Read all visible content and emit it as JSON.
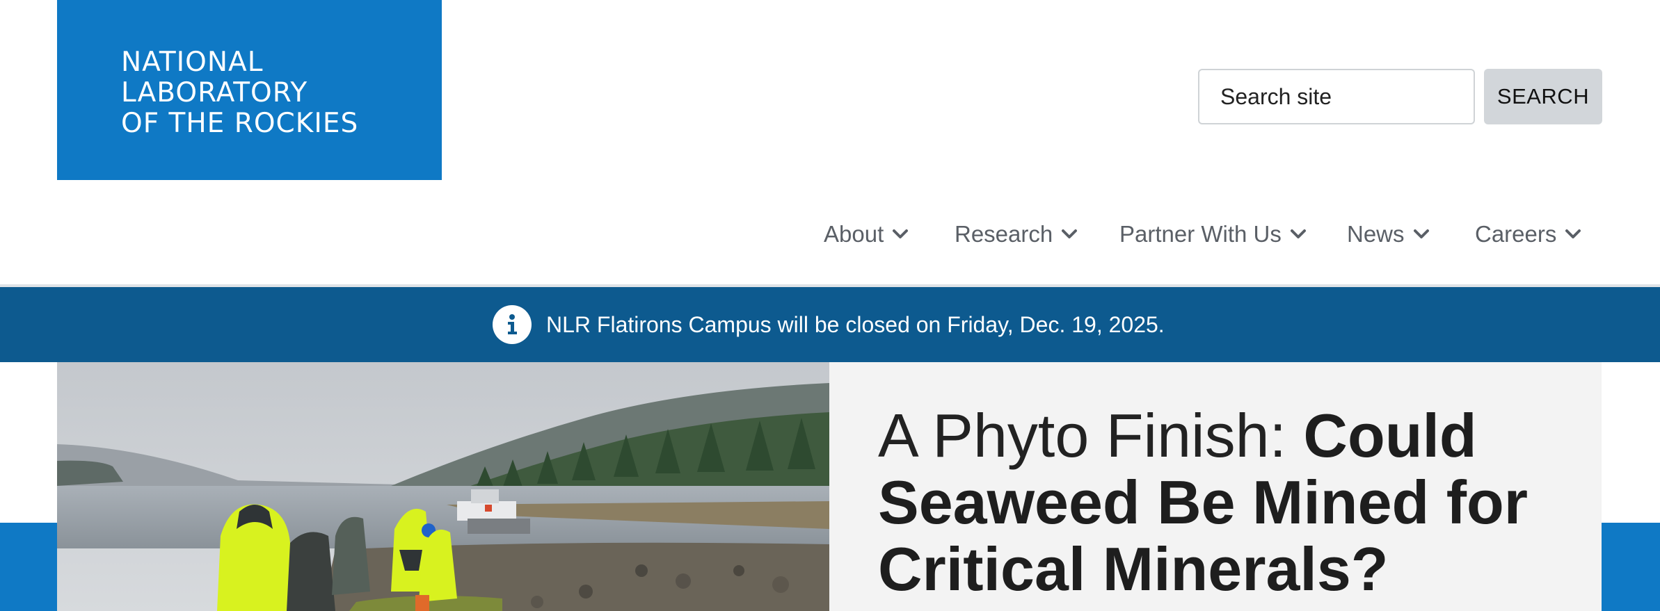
{
  "header": {
    "logo_lines": [
      "NATIONAL",
      "LABORATORY",
      "OF THE ROCKIES"
    ],
    "search": {
      "placeholder": "Search site",
      "button_label": "SEARCH"
    }
  },
  "nav": {
    "items": [
      {
        "label": "About",
        "icon": "chevron-down-icon"
      },
      {
        "label": "Research",
        "icon": "chevron-down-icon"
      },
      {
        "label": "Partner With Us",
        "icon": "chevron-down-icon"
      },
      {
        "label": "News",
        "icon": "chevron-down-icon"
      },
      {
        "label": "Careers",
        "icon": "chevron-down-icon"
      }
    ]
  },
  "alert": {
    "icon": "info-icon",
    "text": "NLR Flatirons Campus will be closed on Friday, Dec. 19, 2025."
  },
  "hero": {
    "title_lead": "A Phyto Finish:",
    "title_strong": "Could Seaweed Be Mined for Critical Minerals?"
  },
  "colors": {
    "brand_blue": "#0f79c5",
    "alert_bar": "#0d5a8f",
    "hero_card_bg": "#f3f3f3",
    "nav_text": "#5a5f66"
  }
}
